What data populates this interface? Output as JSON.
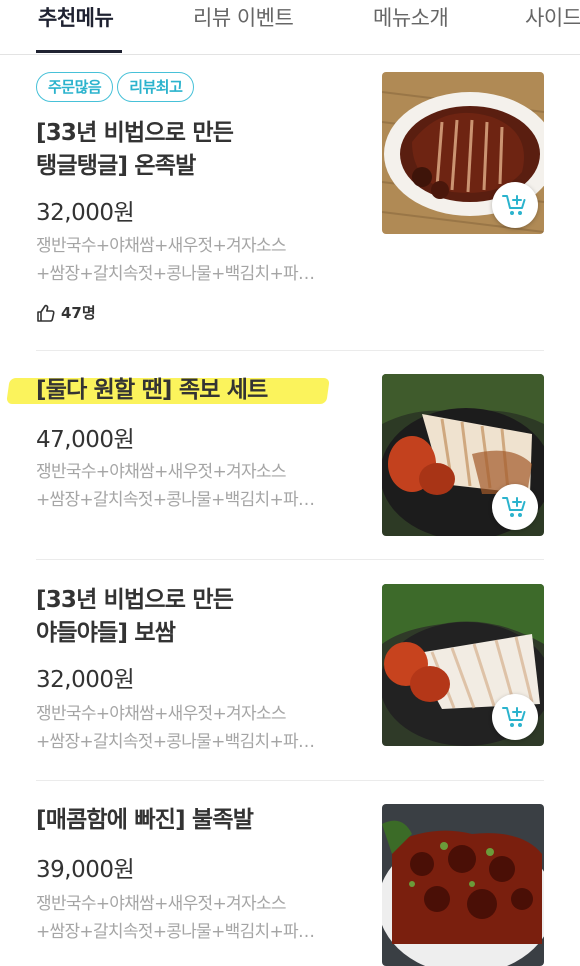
{
  "tabs": [
    {
      "label": "추천메뉴",
      "active": true
    },
    {
      "label": "리뷰 이벤트",
      "active": false
    },
    {
      "label": "메뉴소개",
      "active": false
    },
    {
      "label": "사이드",
      "active": false
    }
  ],
  "menu_items": [
    {
      "badges": [
        "주문많음",
        "리뷰최고"
      ],
      "title_lines": [
        "[33년 비법으로 만든",
        "탱글탱글] 온족발"
      ],
      "price": "32,000원",
      "desc_lines": [
        "쟁반국수+야채쌈+새우젓+겨자소스",
        "+쌈장+갈치속젓+콩나물+백김치+파…"
      ],
      "likes": "47명",
      "image_icon": "braised-pork-trotters-photo",
      "cart_icon": "cart-add-icon"
    },
    {
      "title_lines": [
        "[둘다 원할 땐] 족보 세트"
      ],
      "price": "47,000원",
      "desc_lines": [
        "쟁반국수+야채쌈+새우젓+겨자소스",
        "+쌈장+갈치속젓+콩나물+백김치+파…"
      ],
      "image_icon": "jokbo-set-photo",
      "cart_icon": "cart-add-icon"
    },
    {
      "title_lines": [
        "[33년 비법으로 만든",
        "야들야들] 보쌈"
      ],
      "price": "32,000원",
      "desc_lines": [
        "쟁반국수+야채쌈+새우젓+겨자소스",
        "+쌈장+갈치속젓+콩나물+백김치+파…"
      ],
      "image_icon": "bossam-photo",
      "cart_icon": "cart-add-icon"
    },
    {
      "title_lines": [
        "[매콤함에 빠진] 불족발"
      ],
      "price": "39,000원",
      "desc_lines": [
        "쟁반국수+야채쌈+새우젓+겨자소스",
        "+쌈장+갈치속젓+콩나물+백김치+파…"
      ],
      "image_icon": "spicy-fire-jokbal-photo",
      "cart_icon": "cart-add-icon"
    }
  ],
  "colors": {
    "accent_badge": "#47c1d8",
    "cart_icon": "#2bb3cd",
    "highlight": "#fbf24a",
    "active_tab": "#1f2231"
  }
}
